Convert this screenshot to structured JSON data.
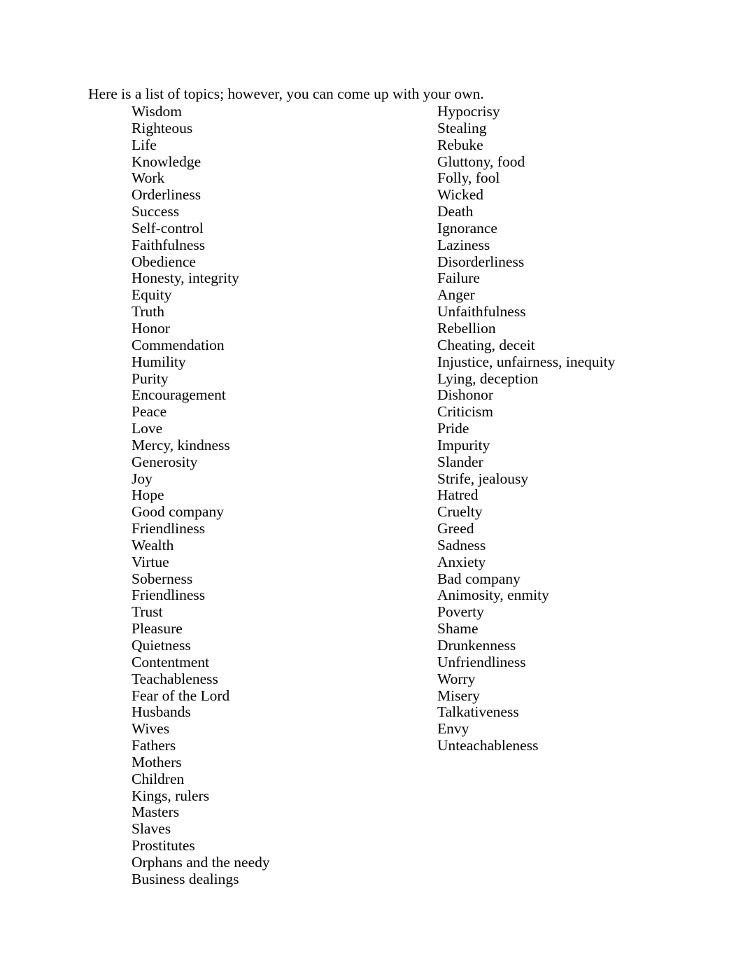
{
  "document": {
    "intro_paragraph": "Here is a list of topics; however, you can come up with your own.",
    "text_color": "#000000",
    "page_background": "#ffffff"
  },
  "columns": {
    "left": {
      "name": "virtues-column",
      "items": [
        "Wisdom",
        "Righteous",
        "Life",
        "Knowledge",
        "Work",
        "Orderliness",
        "Success",
        "Self-control",
        "Faithfulness",
        "Obedience",
        "Honesty, integrity",
        "Equity",
        "Truth",
        "Honor",
        "Commendation",
        "Humility",
        "Purity",
        "Encouragement",
        "Peace",
        "Love",
        "Mercy, kindness",
        "Generosity",
        "Joy",
        "Hope",
        "Good company",
        "Friendliness",
        "Wealth",
        "Virtue",
        "Soberness",
        "Friendliness",
        "Trust",
        "Pleasure",
        "Quietness",
        "Contentment",
        "Teachableness",
        "Fear of the Lord",
        "Husbands",
        "Wives",
        "Fathers",
        "Mothers",
        "Children",
        "Kings, rulers",
        "Masters",
        "Slaves",
        "Prostitutes",
        "Orphans and the needy",
        "Business dealings"
      ]
    },
    "right": {
      "name": "vices-column",
      "items": [
        "Hypocrisy",
        "Stealing",
        "Rebuke",
        "Gluttony, food",
        "Folly, fool",
        "Wicked",
        "Death",
        "Ignorance",
        "Laziness",
        "Disorderliness",
        "Failure",
        "Anger",
        "Unfaithfulness",
        "Rebellion",
        "Cheating, deceit",
        "Injustice, unfairness, inequity",
        "Lying, deception",
        "Dishonor",
        "Criticism",
        "Pride",
        "Impurity",
        "Slander",
        "Strife, jealousy",
        "Hatred",
        "Cruelty",
        "Greed",
        "Sadness",
        "Anxiety",
        "Bad company",
        "Animosity, enmity",
        "Poverty",
        "Shame",
        "Drunkenness",
        "Unfriendliness",
        "Worry",
        "Misery",
        "Talkativeness",
        "Envy",
        "Unteachableness"
      ]
    }
  }
}
